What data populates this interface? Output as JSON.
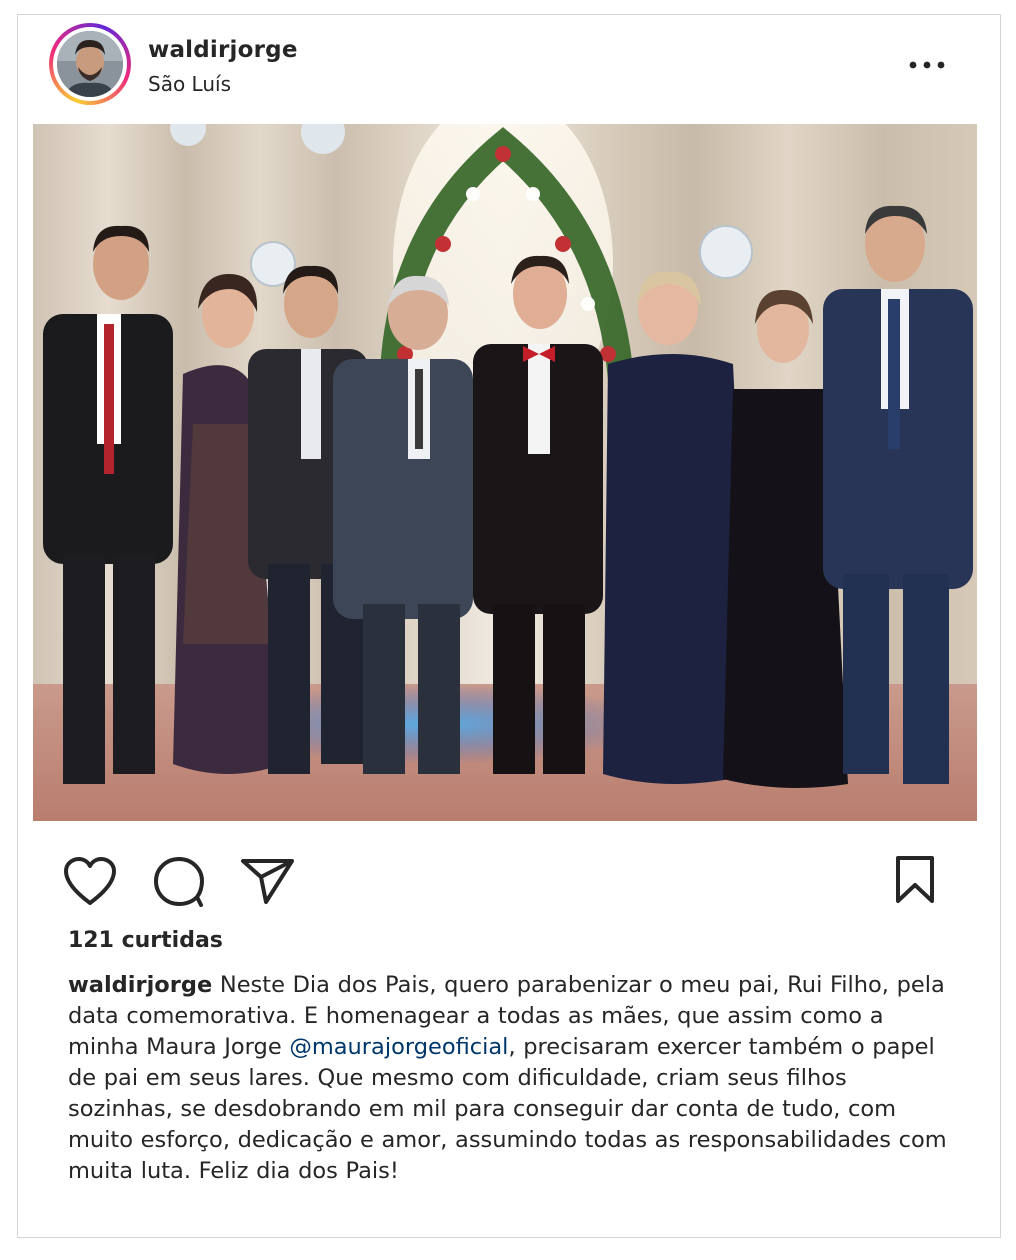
{
  "post": {
    "username": "waldirjorge",
    "location": "São Luís",
    "likes": "121 curtidas",
    "caption": {
      "user": "waldirjorge",
      "text_before": " Neste Dia dos Pais, quero parabenizar o meu pai, Rui Filho, pela data comemorativa. E  homenagear a todas as mães, que assim como a minha Maura Jorge ",
      "mention": "@maurajorgeoficial",
      "text_after": ", precisaram exercer também o papel de pai em seus lares. Que mesmo com dificuldade, criam seus filhos sozinhas, se desdobrando em mil para conseguir dar conta de tudo, com muito esforço, dedicação e amor, assumindo todas as responsabilidades com muita luta. Feliz dia dos Pais!"
    }
  },
  "icons": {
    "more": "more-horizontal-icon",
    "like": "heart-icon",
    "comment": "comment-icon",
    "share": "send-icon",
    "save": "bookmark-icon"
  },
  "colors": {
    "text": "#262626",
    "mention": "#00376b",
    "border": "#d4d4d4",
    "story_ring_start": "#f9ce34",
    "story_ring_mid": "#ee2a7b",
    "story_ring_end": "#6228d7"
  }
}
